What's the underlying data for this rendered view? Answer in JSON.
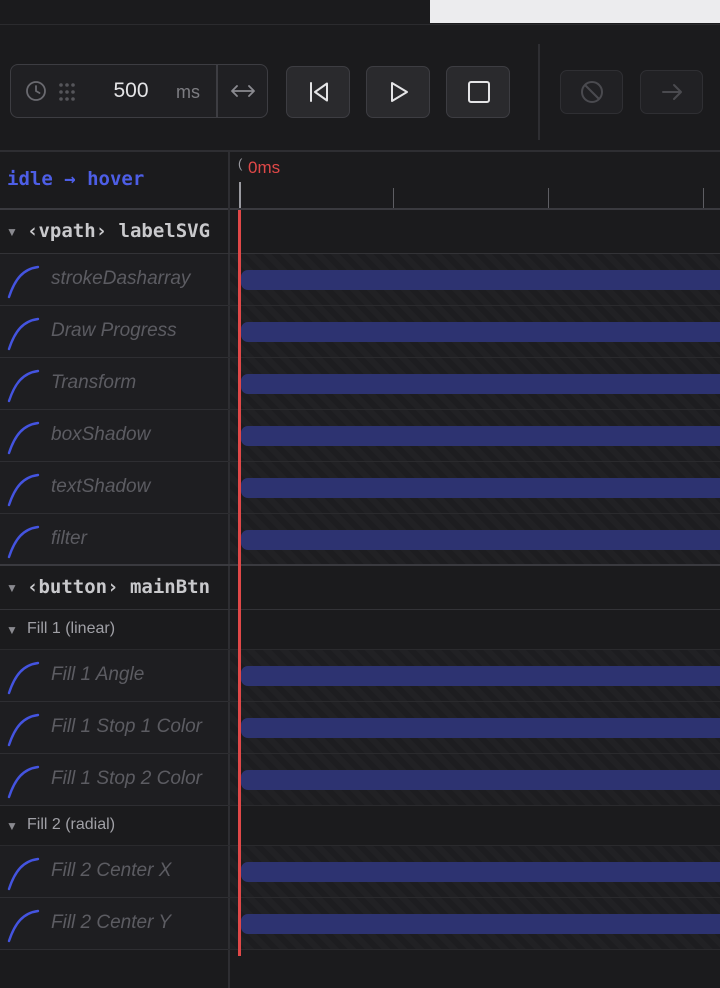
{
  "toolbar": {
    "duration_value": "500",
    "duration_unit": "ms",
    "icons": {
      "clock": "clock-icon",
      "grip": "drag-grip-icon",
      "fit": "horizontal-fit-arrows-icon",
      "skip_start": "skip-to-start-icon",
      "play": "play-icon",
      "stop": "stop-icon",
      "disable": "disabled-circle-icon",
      "next": "arrow-right-icon"
    }
  },
  "timeline": {
    "transition_label": "idle → hover",
    "ruler_start": "0ms",
    "ruler_start_prefix": "("
  },
  "groups": [
    {
      "tag": "‹vpath›",
      "name": "labelSVG",
      "properties": [
        {
          "label": "strokeDasharray"
        },
        {
          "label": "Draw Progress"
        },
        {
          "label": "Transform"
        },
        {
          "label": "boxShadow"
        },
        {
          "label": "textShadow"
        },
        {
          "label": "filter"
        }
      ]
    },
    {
      "tag": "‹button›",
      "name": "mainBtn",
      "subgroups": [
        {
          "label": "Fill 1 (linear)",
          "properties": [
            {
              "label": "Fill 1 Angle"
            },
            {
              "label": "Fill 1 Stop 1 Color"
            },
            {
              "label": "Fill 1 Stop 2 Color"
            }
          ]
        },
        {
          "label": "Fill 2 (radial)",
          "properties": [
            {
              "label": "Fill 2 Center X"
            },
            {
              "label": "Fill 2 Center Y"
            }
          ]
        }
      ]
    }
  ],
  "colors": {
    "accent": "#4d5ee6",
    "playhead": "#e04848",
    "bar": "#2d3371",
    "background": "#1b1b1d"
  }
}
